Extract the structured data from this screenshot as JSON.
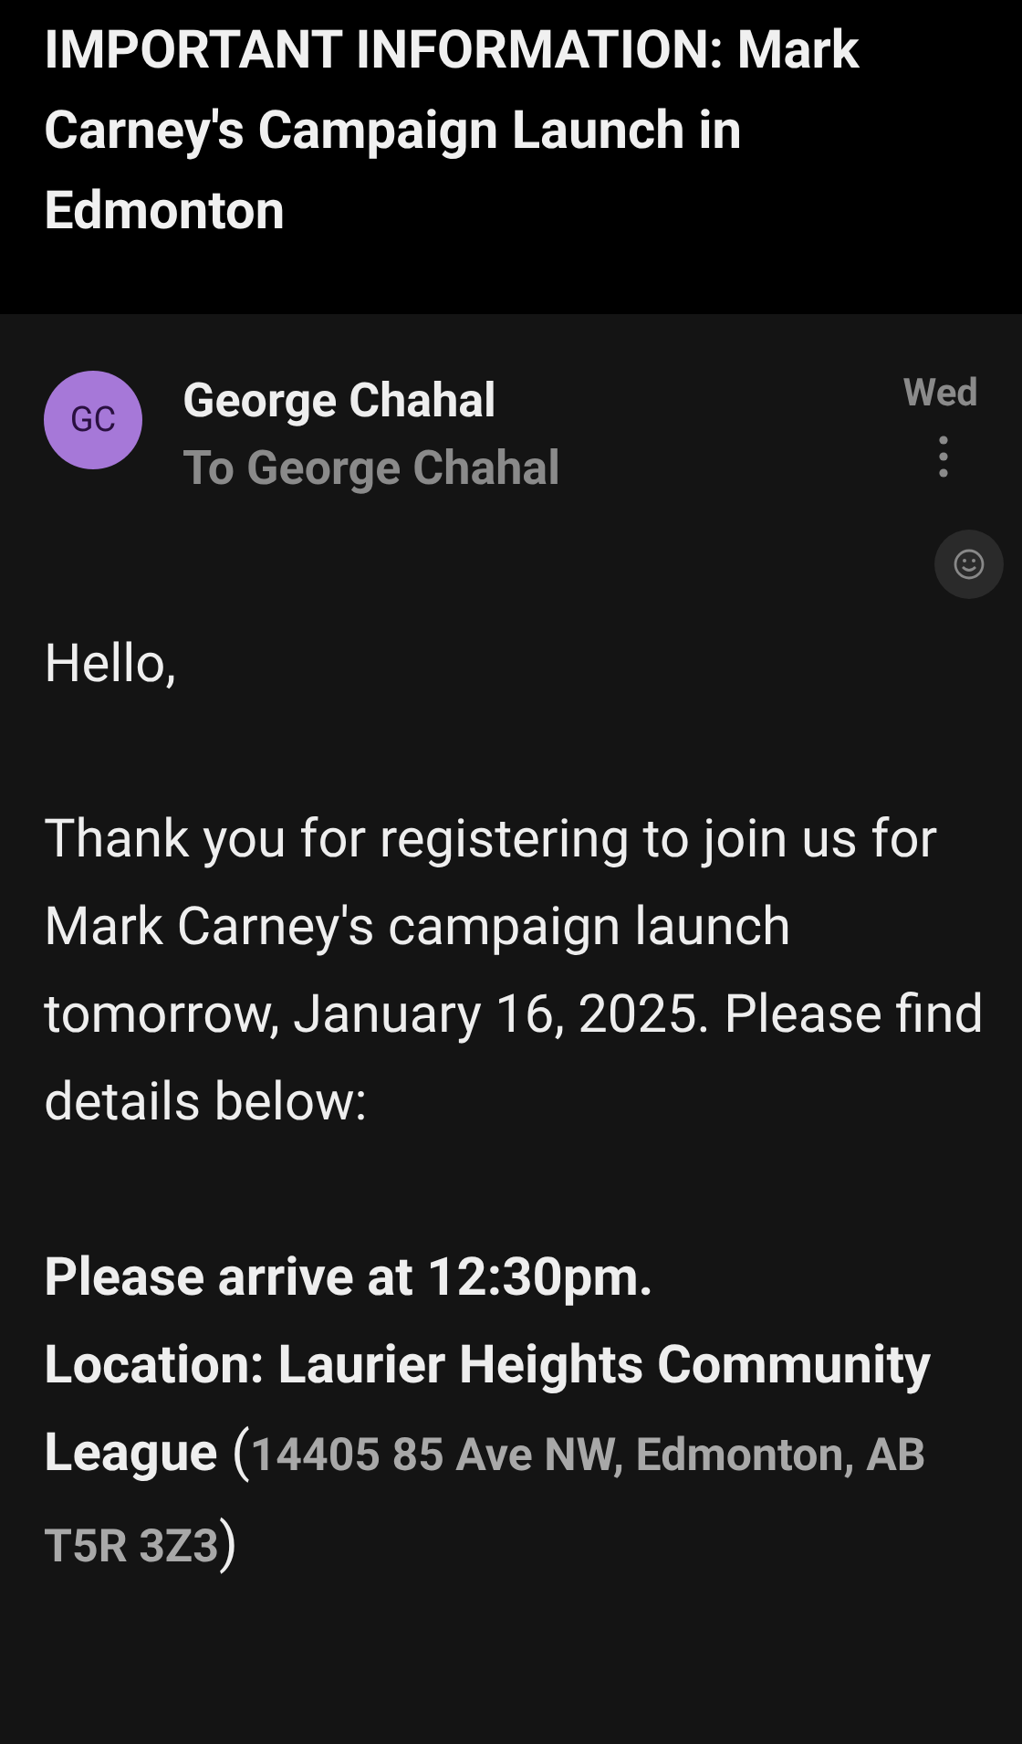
{
  "subject": "IMPORTANT INFORMATION: Mark Carney's Campaign Launch in Edmonton",
  "message": {
    "avatar_initials": "GC",
    "sender": "George Chahal",
    "recipient": "To George Chahal",
    "date": "Wed",
    "body": [
      "Hello,",
      "Thank you for registering to join us for Mark Carney's campaign launch tomorrow, January 16, 2025. Please find details below:"
    ],
    "details": {
      "lines": [
        "Please arrive at 12:30pm.",
        "Location: Laurier Heights Community League"
      ],
      "open": "(",
      "address": "14405 85 Ave NW, Edmonton, AB T5R 3Z3",
      "close": ")"
    }
  }
}
